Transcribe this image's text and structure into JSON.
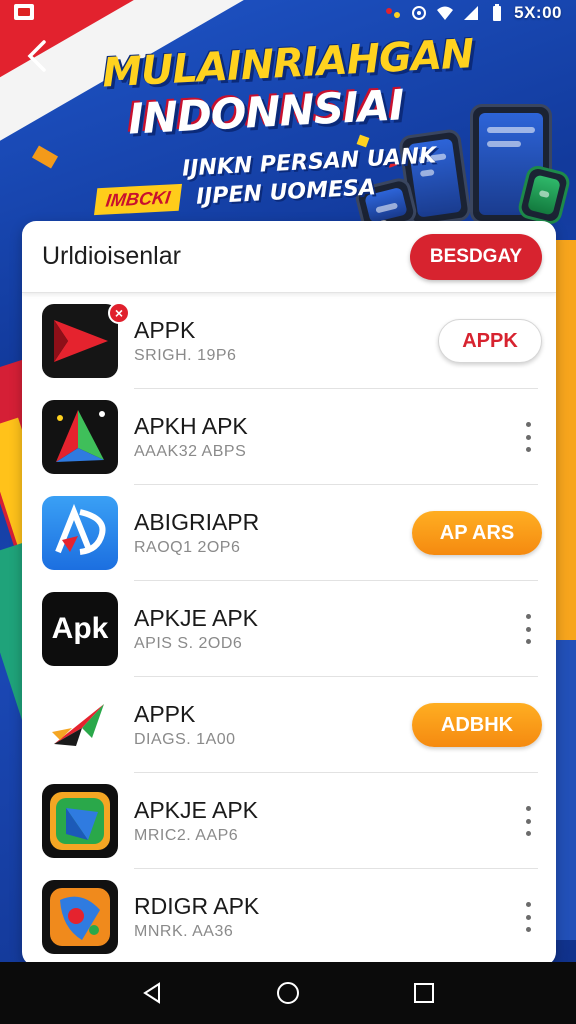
{
  "status_bar": {
    "time": "5X:00"
  },
  "banner": {
    "title_line1": "MULAINRIAHGAN",
    "title_line2": "INDONNSIAI",
    "tagline1": "IJNKN PERSAN UANK",
    "tagline2": "IJPEN UOMESA",
    "badge": "IMBCKI"
  },
  "card": {
    "title": "Urldioisenlar",
    "header_button": "BESDGAY"
  },
  "apps": [
    {
      "name": "APPK",
      "meta": "SRIGH. 19P6",
      "icon": "red-play-arrow-icon",
      "action": "APPK",
      "action_style": "outline",
      "badge": "×"
    },
    {
      "name": "APKH APK",
      "meta": "AAAK32 ABPS",
      "icon": "colorful-arrow-icon",
      "action": "more-options-icon",
      "action_style": "dots"
    },
    {
      "name": "ABIGRIAPR",
      "meta": "RAOQ1 2OP6",
      "icon": "blue-ap-logo-icon",
      "action": "AP ARS",
      "action_style": "orange"
    },
    {
      "name": "APKJE APK",
      "meta": "APIS S. 2OD6",
      "icon": "apk-text-logo-icon",
      "action": "more-options-icon",
      "action_style": "dots"
    },
    {
      "name": "APPK",
      "meta": "DIAGS. 1A00",
      "icon": "red-green-arrow-icon",
      "action": "ADBHK",
      "action_style": "orange"
    },
    {
      "name": "APKJE APK",
      "meta": "MRIC2. AAP6",
      "icon": "green-shield-logo-icon",
      "action": "more-options-icon",
      "action_style": "dots"
    },
    {
      "name": "RDIGR APK",
      "meta": "MNRK. AA36",
      "icon": "orange-app-logo-icon",
      "action": "more-options-icon",
      "action_style": "dots"
    }
  ],
  "nav": {
    "back": "back-triangle-icon",
    "home": "home-circle-icon",
    "recents": "recents-square-icon"
  },
  "colors": {
    "accent_red": "#d7232f",
    "accent_orange": "#f7921a",
    "banner_blue": "#1a47b3",
    "title_yellow": "#ffd21f"
  }
}
